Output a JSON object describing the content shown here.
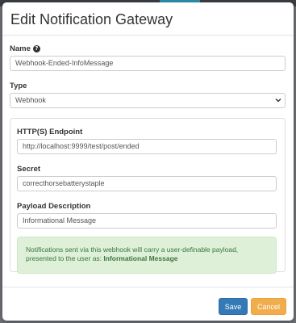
{
  "modal": {
    "title": "Edit Notification Gateway"
  },
  "form": {
    "name_label": "Name",
    "name_value": "Webhook-Ended-InfoMessage",
    "type_label": "Type",
    "type_value": "Webhook",
    "endpoint_label": "HTTP(S) Endpoint",
    "endpoint_value": "http://localhost:9999/test/post/ended",
    "secret_label": "Secret",
    "secret_value": "correcthorsebatterystaple",
    "payload_label": "Payload Description",
    "payload_value": "Informational Message"
  },
  "alert": {
    "text": "Notifications sent via this webhook will carry a user-definable payload, presented to the user as: ",
    "emphasis": "Informational Message"
  },
  "footer": {
    "save_label": "Save",
    "cancel_label": "Cancel"
  },
  "colors": {
    "primary": "#337ab7",
    "warning": "#f0ad4e",
    "success_bg": "#dff0d8",
    "success_text": "#3c763d"
  },
  "icons": {
    "help": "question-circle-icon",
    "select": "chevron-down-icon"
  }
}
